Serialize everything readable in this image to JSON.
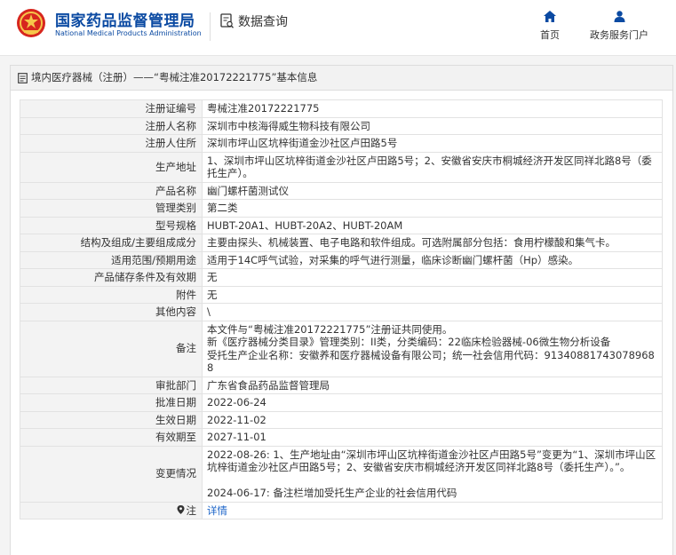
{
  "header": {
    "brand_cn": "国家药品监督管理局",
    "brand_en": "National Medical Products Administration",
    "query_label": "数据查询",
    "nav": {
      "home": "首页",
      "portal": "政务服务门户"
    },
    "accent": "#0b4aa2"
  },
  "panel": {
    "title": "境内医疗器械（注册）——“粤械注准20172221775”基本信息"
  },
  "rows": [
    {
      "label": "注册证编号",
      "value": "粤械注准20172221775"
    },
    {
      "label": "注册人名称",
      "value": "深圳市中核海得威生物科技有限公司"
    },
    {
      "label": "注册人住所",
      "value": "深圳市坪山区坑梓街道金沙社区卢田路5号"
    },
    {
      "label": "生产地址",
      "value": "1、深圳市坪山区坑梓街道金沙社区卢田路5号；2、安徽省安庆市桐城经济开发区同祥北路8号（委托生产）。"
    },
    {
      "label": "产品名称",
      "value": "幽门螺杆菌测试仪"
    },
    {
      "label": "管理类别",
      "value": "第二类"
    },
    {
      "label": "型号规格",
      "value": "HUBT-20A1、HUBT-20A2、HUBT-20AM"
    },
    {
      "label": "结构及组成/主要组成成分",
      "value": "主要由探头、机械装置、电子电路和软件组成。可选附属部分包括：食用柠檬酸和集气卡。"
    },
    {
      "label": "适用范围/预期用途",
      "value": "适用于14C呼气试验，对采集的呼气进行测量，临床诊断幽门螺杆菌（Hp）感染。"
    },
    {
      "label": "产品储存条件及有效期",
      "value": "无"
    },
    {
      "label": "附件",
      "value": "无"
    },
    {
      "label": "其他内容",
      "value": "\\"
    },
    {
      "label": "备注",
      "lines": [
        "本文件与“粤械注准20172221775”注册证共同使用。",
        "新《医疗器械分类目录》管理类别：II类，分类编码：22临床检验器械-06微生物分析设备",
        "受托生产企业名称：安徽养和医疗器械设备有限公司；统一社会信用代码：91340881743078968 8"
      ]
    },
    {
      "label": "审批部门",
      "value": "广东省食品药品监督管理局"
    },
    {
      "label": "批准日期",
      "value": "2022-06-24"
    },
    {
      "label": "生效日期",
      "value": "2022-11-02"
    },
    {
      "label": "有效期至",
      "value": "2027-11-01"
    },
    {
      "label": "变更情况",
      "lines": [
        "2022-08-26: 1、生产地址由“深圳市坪山区坑梓街道金沙社区卢田路5号”变更为“1、深圳市坪山区坑梓街道金沙社区卢田路5号；2、安徽省安庆市桐城经济开发区同祥北路8号（委托生产）。”。",
        "",
        "2024-06-17: 备注栏增加受托生产企业的社会信用代码"
      ]
    },
    {
      "label": "注",
      "value": "详情",
      "is_link": true
    }
  ]
}
